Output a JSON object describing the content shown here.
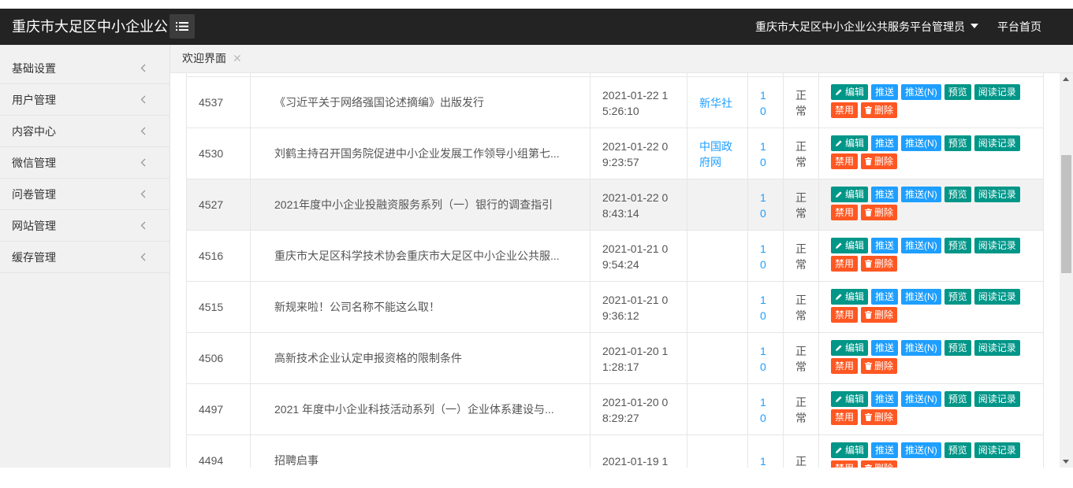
{
  "topbar": {
    "brand": "重庆市大足区中小企业公共服务平台",
    "admin_label": "重庆市大足区中小企业公共服务平台管理员",
    "home_link": "平台首页",
    "background": "#232323"
  },
  "sidebar": {
    "items": [
      {
        "label": "基础设置"
      },
      {
        "label": "用户管理"
      },
      {
        "label": "内容中心"
      },
      {
        "label": "微信管理"
      },
      {
        "label": "问卷管理"
      },
      {
        "label": "网站管理"
      },
      {
        "label": "缓存管理"
      }
    ]
  },
  "tabs": [
    {
      "label": "欢迎界面",
      "active": true
    }
  ],
  "actions": {
    "edit": "编辑",
    "push": "推送",
    "push_n": "推送(N)",
    "preview": "预览",
    "read_log": "阅读记录",
    "disable": "禁用",
    "delete": "删除"
  },
  "colors": {
    "green": "#009688",
    "blue": "#1e9fff",
    "orange": "#ff5722"
  },
  "articles": [
    {
      "id": "4537",
      "title": "《习近平关于网络强国论述摘编》出版发行",
      "date": "2021-01-22 1",
      "time": "5:26:10",
      "source": [
        "新华社",
        ""
      ],
      "views": [
        "1",
        "0"
      ],
      "status": [
        "正",
        "常"
      ]
    },
    {
      "id": "4530",
      "title": "刘鹤主持召开国务院促进中小企业发展工作领导小组第七...",
      "date": "2021-01-22 0",
      "time": "9:23:57",
      "source": [
        "中国政",
        "府网"
      ],
      "views": [
        "1",
        "0"
      ],
      "status": [
        "正",
        "常"
      ]
    },
    {
      "id": "4527",
      "title": "2021年度中小企业投融资服务系列（一）银行的调查指引",
      "date": "2021-01-22 0",
      "time": "8:43:14",
      "source": [
        "",
        ""
      ],
      "views": [
        "1",
        "0"
      ],
      "status": [
        "正",
        "常"
      ]
    },
    {
      "id": "4516",
      "title": "重庆市大足区科学技术协会重庆市大足区中小企业公共服...",
      "date": "2021-01-21 0",
      "time": "9:54:24",
      "source": [
        "",
        ""
      ],
      "views": [
        "1",
        "0"
      ],
      "status": [
        "正",
        "常"
      ]
    },
    {
      "id": "4515",
      "title": "新规来啦！公司名称不能这么取！",
      "date": "2021-01-21 0",
      "time": "9:36:12",
      "source": [
        "",
        ""
      ],
      "views": [
        "1",
        "0"
      ],
      "status": [
        "正",
        "常"
      ]
    },
    {
      "id": "4506",
      "title": "高新技术企业认定申报资格的限制条件",
      "date": "2021-01-20 1",
      "time": "1:28:17",
      "source": [
        "",
        ""
      ],
      "views": [
        "1",
        "0"
      ],
      "status": [
        "正",
        "常"
      ]
    },
    {
      "id": "4497",
      "title": "2021 年度中小企业科技活动系列（一）企业体系建设与...",
      "date": "2021-01-20 0",
      "time": "8:29:27",
      "source": [
        "",
        ""
      ],
      "views": [
        "1",
        "0"
      ],
      "status": [
        "正",
        "常"
      ]
    },
    {
      "id": "4494",
      "title": "招聘启事",
      "date": "2021-01-19 1",
      "time": "",
      "source": [
        "",
        ""
      ],
      "views": [
        "1",
        ""
      ],
      "status": [
        "正",
        ""
      ]
    }
  ]
}
